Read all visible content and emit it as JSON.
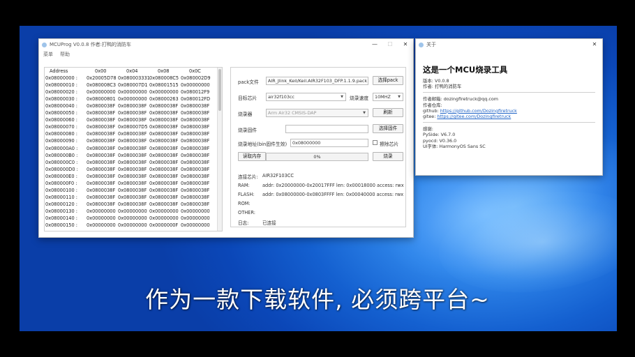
{
  "main_window": {
    "title": "MCUProg V0.0.8 作者:打鸭的消防车",
    "controls": {
      "minimize": "—",
      "maximize": "☐",
      "close": "✕"
    },
    "menu": [
      "菜单",
      "帮助"
    ]
  },
  "memory_table": {
    "headers": [
      "Address",
      "0x00",
      "0x04",
      "0x08",
      "0x0C"
    ],
    "rows": [
      [
        "0x08000000 :",
        "0x20005D78",
        "0x080003331",
        "0x080008C5",
        "0x080002D9"
      ],
      [
        "0x08000010 :",
        "0x080008C3",
        "0x080007D1",
        "0x08001515",
        "0x00000000"
      ],
      [
        "0x08000020 :",
        "0x00000000",
        "0x00000000",
        "0x00000000",
        "0x080012F9"
      ],
      [
        "0x08000030 :",
        "0x08000801",
        "0x00000000",
        "0x08000263",
        "0x080012FD"
      ],
      [
        "0x08000040 :",
        "0x0800038F",
        "0x0800038F",
        "0x0800038F",
        "0x0800038F"
      ],
      [
        "0x08000050 :",
        "0x0800038F",
        "0x0800038F",
        "0x0800038F",
        "0x0800038F"
      ],
      [
        "0x08000060 :",
        "0x0800038F",
        "0x0800038F",
        "0x0800038F",
        "0x0800038F"
      ],
      [
        "0x08000070 :",
        "0x0800038F",
        "0x080007D5",
        "0x0800038F",
        "0x0800038F"
      ],
      [
        "0x08000080 :",
        "0x0800038F",
        "0x0800038F",
        "0x0800038F",
        "0x0800038F"
      ],
      [
        "0x08000090 :",
        "0x0800038F",
        "0x0800038F",
        "0x0800038F",
        "0x0800038F"
      ],
      [
        "0x080000A0 :",
        "0x0800038F",
        "0x0800038F",
        "0x0800038F",
        "0x0800038F"
      ],
      [
        "0x080000B0 :",
        "0x0800038F",
        "0x0800038F",
        "0x0800038F",
        "0x0800038F"
      ],
      [
        "0x080000C0 :",
        "0x0800038F",
        "0x0800038F",
        "0x0800038F",
        "0x0800038F"
      ],
      [
        "0x080000D0 :",
        "0x0800038F",
        "0x0800038F",
        "0x0800038F",
        "0x0800038F"
      ],
      [
        "0x080000E0 :",
        "0x0800038F",
        "0x0800038F",
        "0x0800038F",
        "0x0800038F"
      ],
      [
        "0x080000F0 :",
        "0x0800038F",
        "0x0800038F",
        "0x0800038F",
        "0x0800038F"
      ],
      [
        "0x08000100 :",
        "0x0800038F",
        "0x0800038F",
        "0x0800038F",
        "0x0800038F"
      ],
      [
        "0x08000110 :",
        "0x0800038F",
        "0x0800038F",
        "0x0800038F",
        "0x0800038F"
      ],
      [
        "0x08000120 :",
        "0x0800038F",
        "0x0800038F",
        "0x0800038F",
        "0x0800038F"
      ],
      [
        "0x08000130 :",
        "0x00000000",
        "0x00000000",
        "0x00000000",
        "0x00000000"
      ],
      [
        "0x08000140 :",
        "0x00000000",
        "0x00000000",
        "0x00000000",
        "0x00000000"
      ],
      [
        "0x08000150 :",
        "0x00000000",
        "0x00000000",
        "0x0000000F",
        "0x00000000"
      ]
    ]
  },
  "controls": {
    "pack_label": "pack文件",
    "pack_value": "AIR_Jlink_Keil/Keil.AIR32F103_DFP.1.1.9.pack",
    "pack_button": "选择pack",
    "target_label": "目标芯片",
    "target_value": "air32f103cc",
    "speed_label": "烧录速度",
    "speed_value": "10MHZ",
    "programmer_label": "烧录器",
    "programmer_value": "Arm Air32 CMSIS-DAP",
    "refresh_button": "刷新",
    "firmware_label": "烧录固件",
    "firmware_value": "",
    "firmware_button": "选择固件",
    "address_label": "烧录地址(bin固件生效)",
    "address_value": "0x08000000",
    "erase_label": "擦除芯片",
    "read_button": "读取内存",
    "progress_text": "0%",
    "burn_button": "烧录"
  },
  "chip_info": {
    "connected_label": "连接芯片:",
    "connected_value": "AIR32F103CC",
    "ram_label": "RAM:",
    "ram_value": "addr: 0x20000000-0x20017FFF len: 0x00018000 access: rwx",
    "flash_label": "FLASH:",
    "flash_value": "addr: 0x08000000-0x0803FFFF len: 0x00040000 access: rwx",
    "rom_label": "ROM:",
    "other_label": "OTHER:",
    "log_label": "日志:",
    "log_value": "已连接"
  },
  "about_window": {
    "title": "关于",
    "close": "✕",
    "heading": "这是一个MCU烧录工具",
    "version": "版本: V0.0.8",
    "author": "作者: 打鸭的消防车",
    "email": "作者邮箱: dozingfiretruck@qq.com",
    "repo_label": "作者仓库:",
    "github_label": "github:",
    "github_url": "https://github.com/Dozingfiretruck",
    "gitee_label": "gitee:",
    "gitee_url": "https://gitee.com/Dozingfiretruck",
    "thanks": "感谢:",
    "pyside": "PySide: V6.7.0",
    "pyocd": "pyocd: V0.36.0",
    "font": "UI字体: HarmonyOS Sans SC"
  },
  "subtitle": "作为一款下载软件, 必须跨平台~",
  "colors": {
    "desktop_blue": "#1460d0",
    "link": "#1f63c6"
  }
}
